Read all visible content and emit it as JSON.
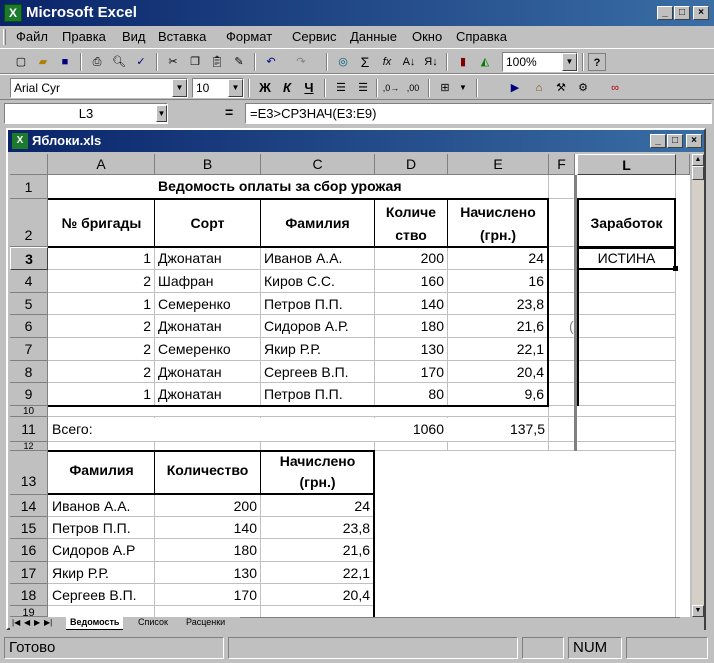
{
  "app": {
    "title": "Microsoft Excel"
  },
  "menu": [
    "Файл",
    "Правка",
    "Вид",
    "Вставка",
    "Формат",
    "Сервис",
    "Данные",
    "Окно",
    "Справка"
  ],
  "toolbar": {
    "zoom": "100%",
    "font": "Arial Cyr",
    "size": "10",
    "bold": "Ж",
    "italic": "К",
    "underline": "Ч",
    "sum": "Σ",
    "fx": "fx",
    "help": "?"
  },
  "formula_bar": {
    "name_box": "L3",
    "eq": "=",
    "formula": "=E3>СРЗНАЧ(E3:E9)"
  },
  "workbook": {
    "title": "Яблоки.xls"
  },
  "columns": [
    "A",
    "B",
    "C",
    "D",
    "E",
    "F",
    "L"
  ],
  "rows": [
    "1",
    "2",
    "3",
    "4",
    "5",
    "6",
    "7",
    "8",
    "9",
    "10",
    "11",
    "12",
    "13",
    "14",
    "15",
    "16",
    "17",
    "18",
    "19"
  ],
  "table1": {
    "title": "Ведомость оплаты за сбор урожая",
    "headers": [
      "№ бригады",
      "Сорт",
      "Фамилия",
      "Количе",
      "ство",
      "Начислено",
      "(грн.)"
    ],
    "data": [
      [
        "1",
        "Джонатан",
        "Иванов А.А.",
        "200",
        "24"
      ],
      [
        "2",
        "Шафран",
        "Киров С.С.",
        "160",
        "16"
      ],
      [
        "1",
        "Семеренко",
        "Петров П.П.",
        "140",
        "23,8"
      ],
      [
        "2",
        "Джонатан",
        "Сидоров А.Р.",
        "180",
        "21,6"
      ],
      [
        "2",
        "Семеренко",
        "Якир Р.Р.",
        "130",
        "22,1"
      ],
      [
        "2",
        "Джонатан",
        "Сергеев В.П.",
        "170",
        "20,4"
      ],
      [
        "1",
        "Джонатан",
        "Петров П.П.",
        "80",
        "9,6"
      ]
    ],
    "total_label": "Всего:",
    "total_qty": "1060",
    "total_sum": "137,5"
  },
  "l_column": {
    "header": "Заработок",
    "value": "ИСТИНА",
    "stub": "("
  },
  "table2": {
    "headers": [
      "Фамилия",
      "Количество",
      "Начислено",
      "(грн.)"
    ],
    "data": [
      [
        "Иванов А.А.",
        "200",
        "24"
      ],
      [
        "Петров П.П.",
        "140",
        "23,8"
      ],
      [
        "Сидоров А.Р",
        "180",
        "21,6"
      ],
      [
        "Якир Р.Р.",
        "130",
        "22,1"
      ],
      [
        "Сергеев В.П.",
        "170",
        "20,4"
      ]
    ]
  },
  "sheets": [
    "Ведомость",
    "Список",
    "Расценки"
  ],
  "status": {
    "ready": "Готово",
    "num": "NUM"
  }
}
